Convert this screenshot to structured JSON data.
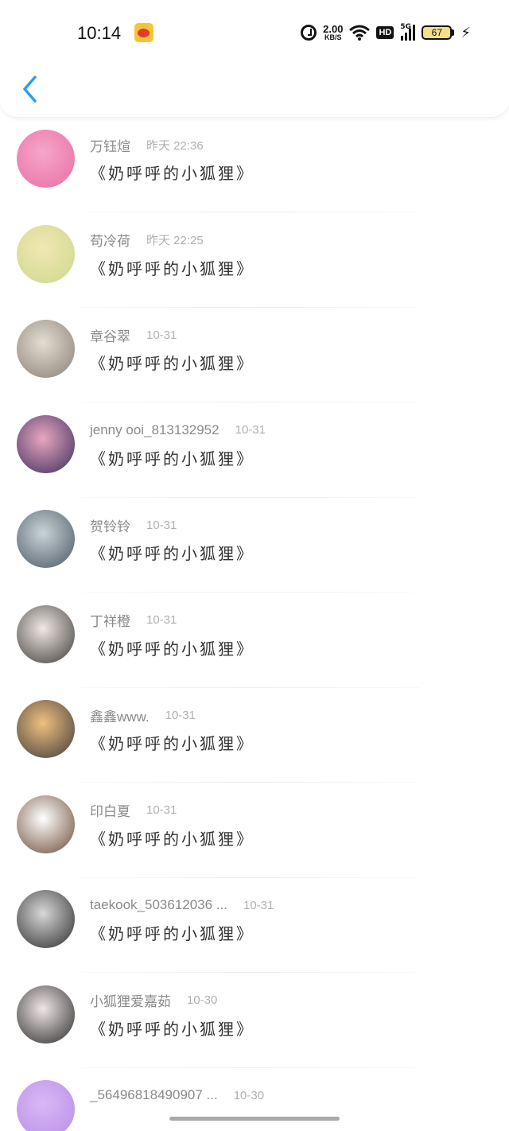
{
  "status_bar": {
    "time": "10:14",
    "net_speed_value": "2.00",
    "net_speed_unit": "KB/S",
    "hd_label": "HD",
    "signal_label": "5G",
    "battery_level": "67",
    "icons": [
      "weibo-icon",
      "alarm-icon",
      "wifi-icon",
      "hd-icon",
      "signal-icon",
      "battery-icon",
      "charging-icon"
    ]
  },
  "header": {
    "back_icon": "chevron-left-icon",
    "accent_color": "#2c9df0"
  },
  "messages": [
    {
      "name": "万钰煊",
      "date": "昨天 22:36",
      "text": "《奶呼呼的小狐狸》",
      "avatar_colors": [
        "#f6a6c8",
        "#e76fa6"
      ]
    },
    {
      "name": "苟冷荷",
      "date": "昨天 22:25",
      "text": "《奶呼呼的小狐狸》",
      "avatar_colors": [
        "#f1e7b4",
        "#cdd98a"
      ]
    },
    {
      "name": "章谷翠",
      "date": "10-31",
      "text": "《奶呼呼的小狐狸》",
      "avatar_colors": [
        "#e3ddd2",
        "#8b7f74"
      ]
    },
    {
      "name": "jenny ooi_813132952",
      "date": "10-31",
      "text": "《奶呼呼的小狐狸》",
      "avatar_colors": [
        "#e9a6c0",
        "#3b2d5c"
      ]
    },
    {
      "name": "贺铃铃",
      "date": "10-31",
      "text": "《奶呼呼的小狐狸》",
      "avatar_colors": [
        "#c9d3d9",
        "#4b5863"
      ]
    },
    {
      "name": "丁祥橙",
      "date": "10-31",
      "text": "《奶呼呼的小狐狸》",
      "avatar_colors": [
        "#efe8e6",
        "#3e3b37"
      ]
    },
    {
      "name": "鑫鑫www.",
      "date": "10-31",
      "text": "《奶呼呼的小狐狸》",
      "avatar_colors": [
        "#f0c07f",
        "#3f3a3a"
      ]
    },
    {
      "name": "印白夏",
      "date": "10-31",
      "text": "《奶呼呼的小狐狸》",
      "avatar_colors": [
        "#ffffff",
        "#6b4a35"
      ]
    },
    {
      "name": "taekook_503612036 ...",
      "date": "10-31",
      "text": "《奶呼呼的小狐狸》",
      "avatar_colors": [
        "#d8d8d8",
        "#2b2b2b"
      ]
    },
    {
      "name": "小狐狸爱嘉茹",
      "date": "10-30",
      "text": "《奶呼呼的小狐狸》",
      "avatar_colors": [
        "#efe6e6",
        "#2a2a2a"
      ]
    },
    {
      "name": "_56496818490907 ...",
      "date": "10-30",
      "text": "",
      "avatar_colors": [
        "#d9b8f5",
        "#b88ee8"
      ]
    }
  ]
}
